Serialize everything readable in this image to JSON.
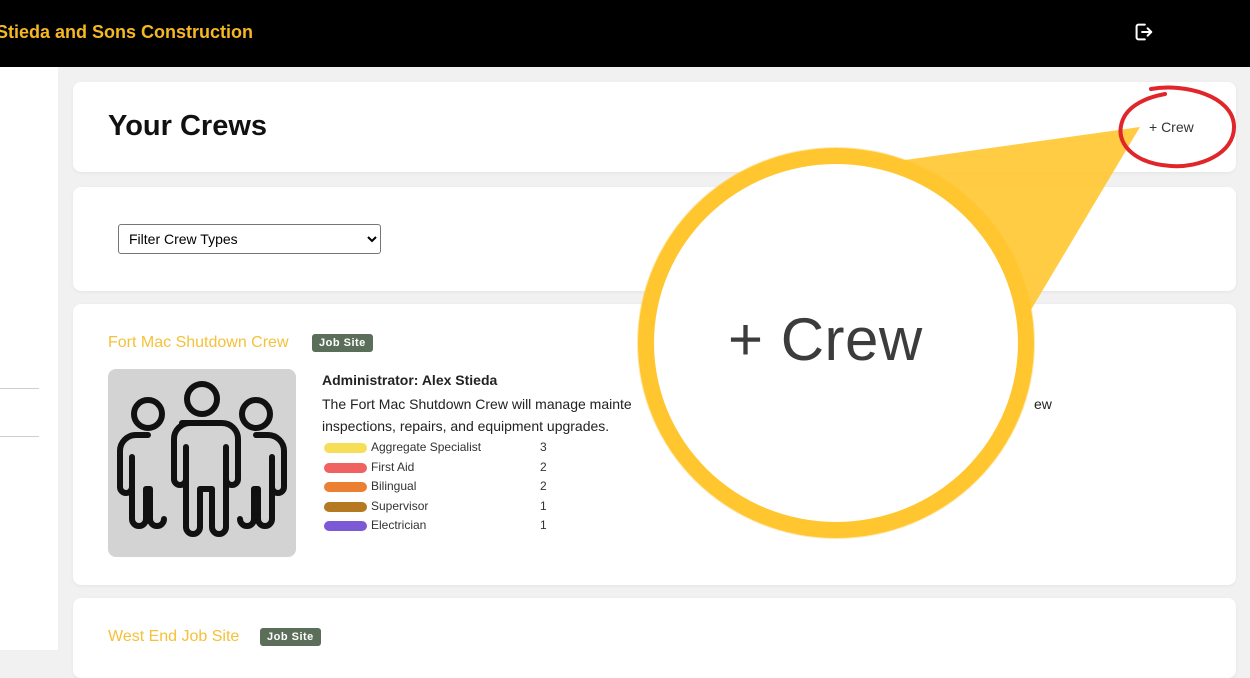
{
  "app": {
    "brand": "Stieda and Sons Construction",
    "logout_icon": "logout-icon"
  },
  "header": {
    "title": "Your Crews",
    "add_crew_label": "+ Crew"
  },
  "filter": {
    "selected": "Filter Crew Types"
  },
  "crews": [
    {
      "name": "Fort Mac Shutdown Crew",
      "badge": "Job Site",
      "avatar_icon": "crew-group-icon",
      "administrator": "Administrator: Alex Stieda",
      "description_start": "The Fort Mac Shutdown Crew will manage mainte",
      "description_tail": "ew",
      "description_line2": "inspections, repairs, and equipment upgrades.",
      "skills": [
        {
          "label": "Aggregate Specialist",
          "count": "3",
          "color": "#f7de58"
        },
        {
          "label": "First Aid",
          "count": "2",
          "color": "#f06262"
        },
        {
          "label": "Bilingual",
          "count": "2",
          "color": "#ec8032"
        },
        {
          "label": "Supervisor",
          "count": "1",
          "color": "#b57a21"
        },
        {
          "label": "Electrician",
          "count": "1",
          "color": "#7c5ad6"
        }
      ]
    },
    {
      "name": "West End Job Site",
      "badge": "Job Site"
    }
  ],
  "callout": {
    "zoom_text": "+ Crew",
    "circle_color": "#ffc630",
    "ring_color": "#e0262b"
  },
  "colors": {
    "topbar": "#000000",
    "brand": "#f5b823",
    "crew_name": "#f5c13a",
    "badge_bg": "#5a6e59"
  }
}
